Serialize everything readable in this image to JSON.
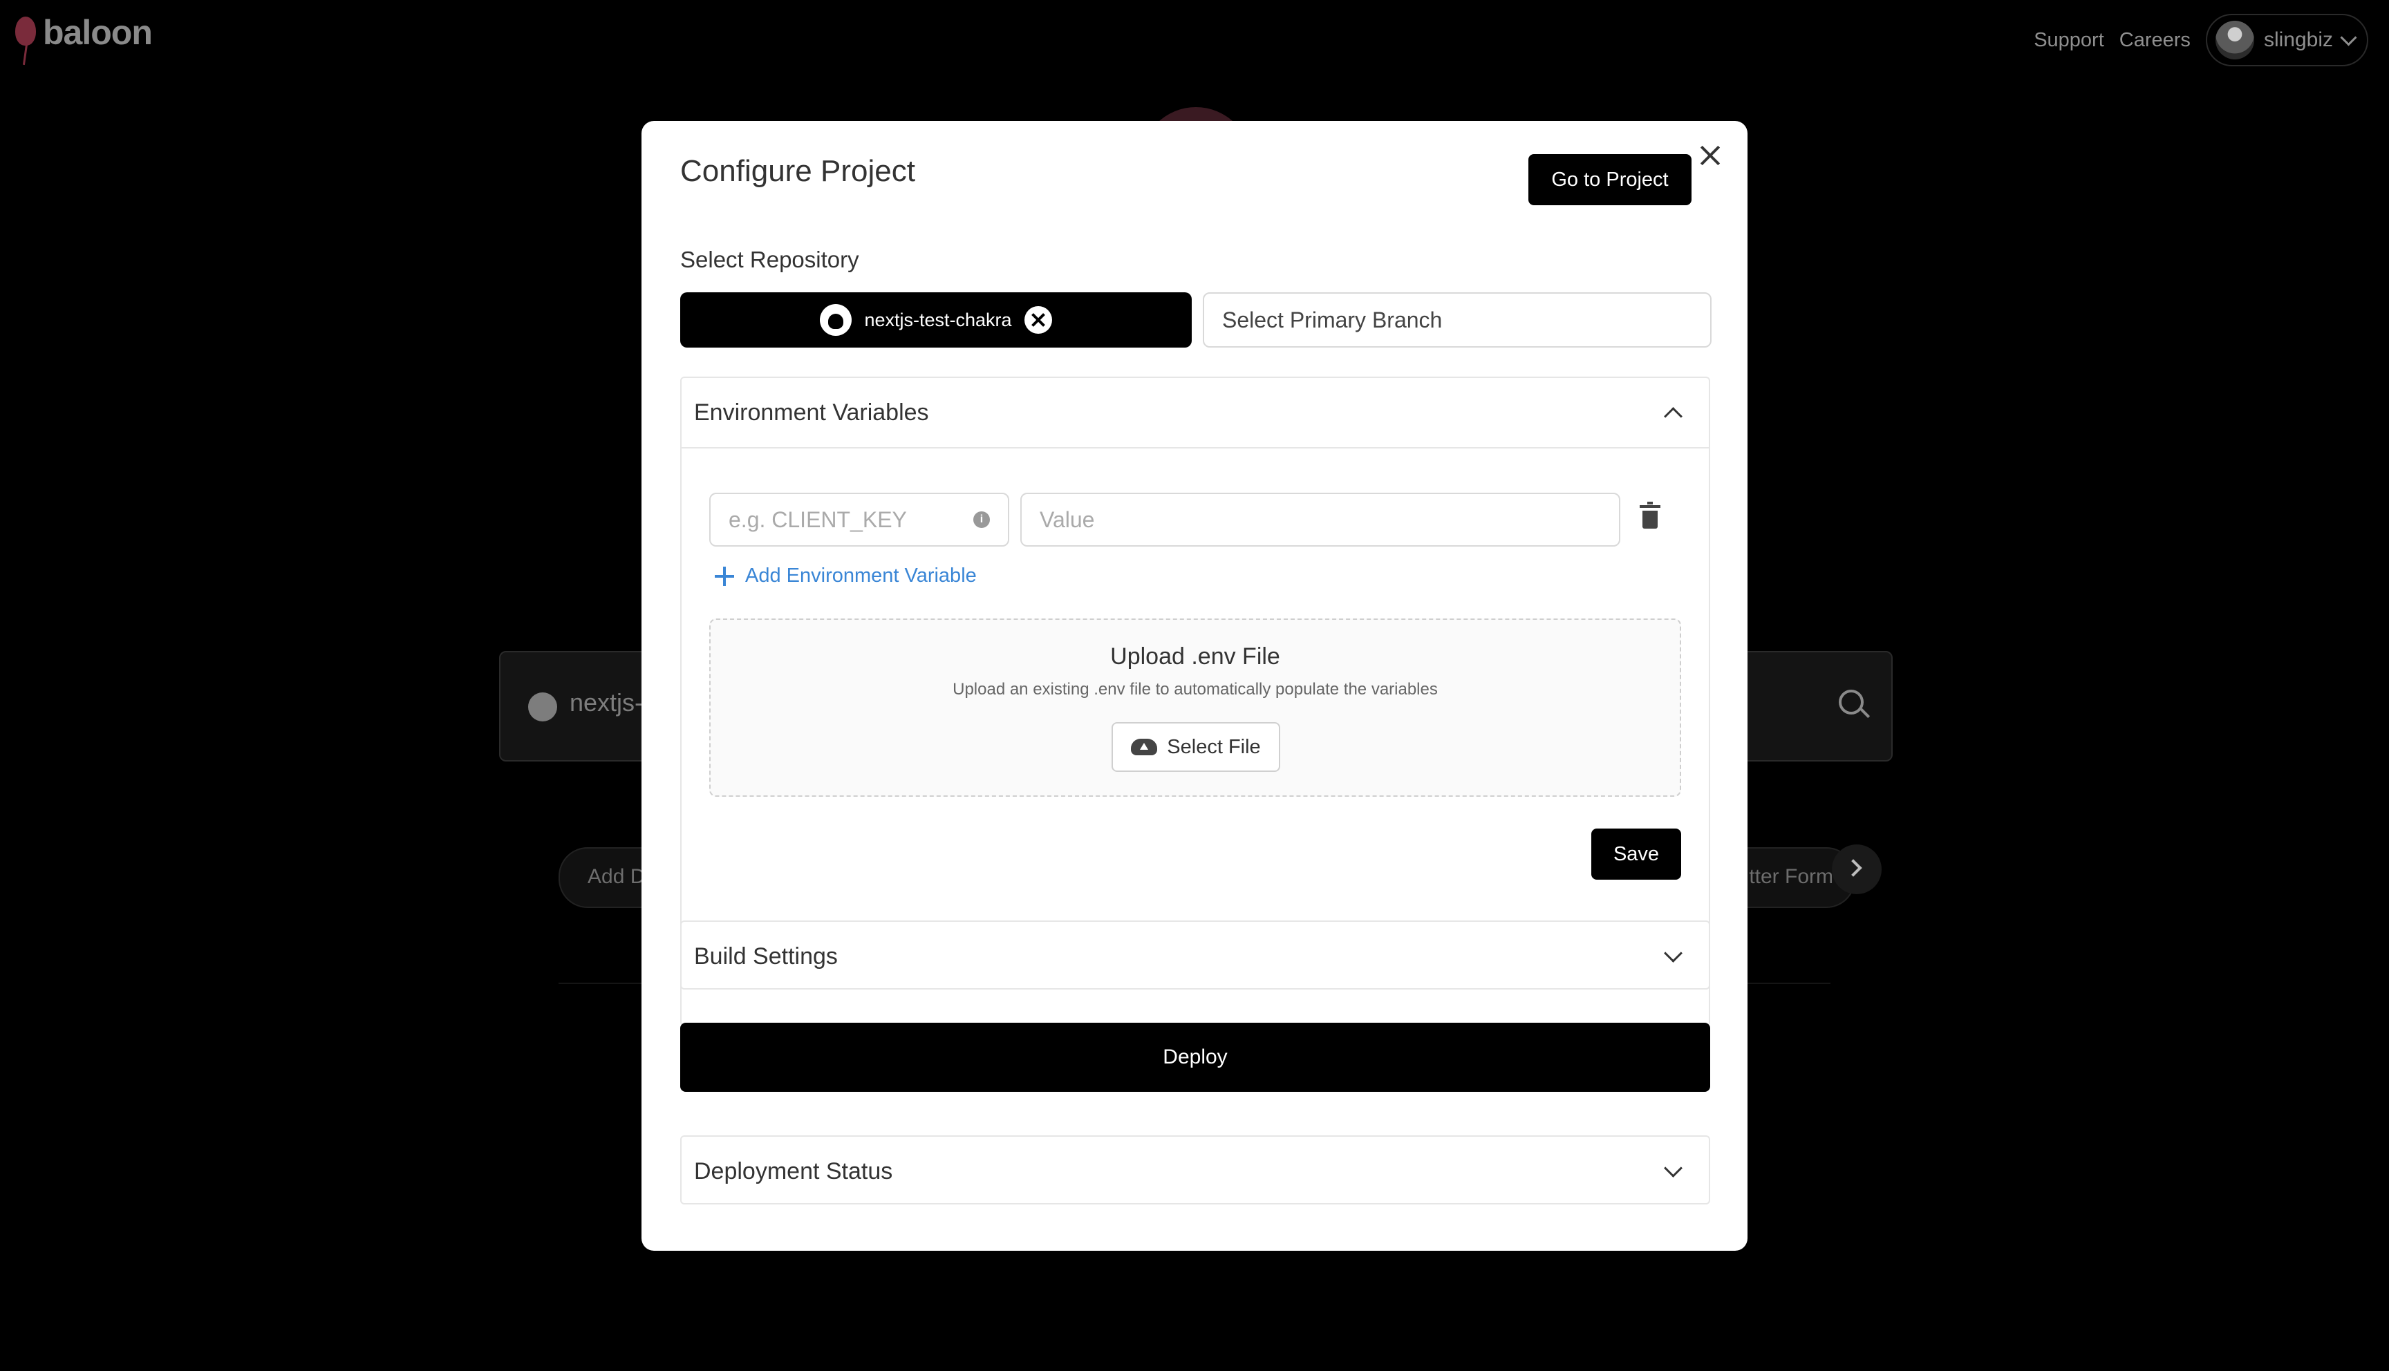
{
  "app": {
    "logo_text": "baloon",
    "nav": {
      "support": "Support",
      "careers": "Careers",
      "user": "slingbiz"
    }
  },
  "background": {
    "search_text": "nextjs-",
    "pill_left": "Add D",
    "pill_right": "tter Form"
  },
  "modal": {
    "title": "Configure Project",
    "goto_button": "Go to Project",
    "repo_label": "Select Repository",
    "repo_selected": "nextjs-test-chakra",
    "branch_placeholder": "Select Primary Branch",
    "env": {
      "header": "Environment Variables",
      "key_placeholder": "e.g. CLIENT_KEY",
      "value_placeholder": "Value",
      "add_label": "Add Environment Variable",
      "upload_title": "Upload .env File",
      "upload_sub": "Upload an existing .env file to automatically populate the variables",
      "select_file": "Select File",
      "save": "Save"
    },
    "build_settings": "Build Settings",
    "deploy": "Deploy",
    "deployment_status": "Deployment Status"
  }
}
